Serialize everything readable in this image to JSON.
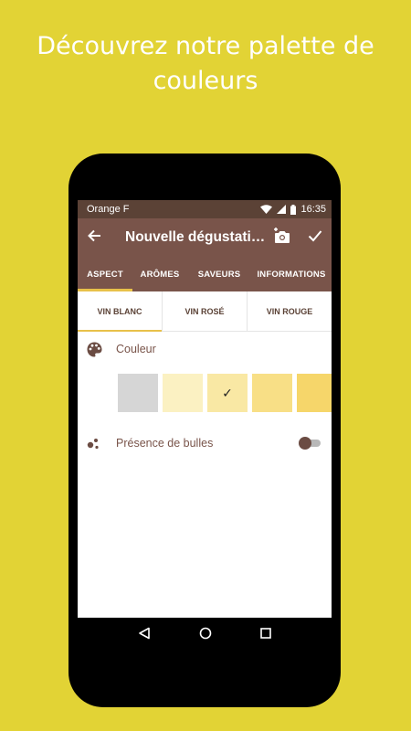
{
  "headline": {
    "line1": "Découvrez notre palette de",
    "line2": "couleurs"
  },
  "status_bar": {
    "carrier": "Orange F",
    "time": "16:35",
    "icons": [
      "wifi-icon",
      "signal-icon",
      "battery-icon"
    ]
  },
  "app_bar": {
    "title": "Nouvelle dégustati…",
    "back_icon": "arrow-left-icon",
    "camera_icon": "add-photo-icon",
    "confirm_icon": "check-icon"
  },
  "tabs": [
    {
      "label": "ASPECT",
      "active": true
    },
    {
      "label": "ARÔMES",
      "active": false
    },
    {
      "label": "SAVEURS",
      "active": false
    },
    {
      "label": "INFORMATIONS",
      "active": false
    }
  ],
  "subtabs": [
    {
      "label": "VIN BLANC",
      "active": true
    },
    {
      "label": "VIN ROSÉ",
      "active": false
    },
    {
      "label": "VIN ROUGE",
      "active": false
    }
  ],
  "couleur": {
    "label": "Couleur",
    "icon": "palette-icon",
    "swatches": [
      {
        "color": "#d6d6d6",
        "selected": false
      },
      {
        "color": "#fbf1c2",
        "selected": false
      },
      {
        "color": "#f9e8a4",
        "selected": true,
        "mark": "✓"
      },
      {
        "color": "#f8df86",
        "selected": false
      },
      {
        "color": "#f6d66a",
        "selected": false
      }
    ]
  },
  "bulles": {
    "label": "Présence de bulles",
    "icon": "bubbles-icon",
    "enabled": false
  },
  "nav": [
    "back-nav-icon",
    "home-nav-icon",
    "recents-nav-icon"
  ],
  "colors": {
    "background": "#e2d335",
    "status_bar": "#5b4236",
    "app_bar": "#79544a",
    "accent": "#e8c14a"
  }
}
